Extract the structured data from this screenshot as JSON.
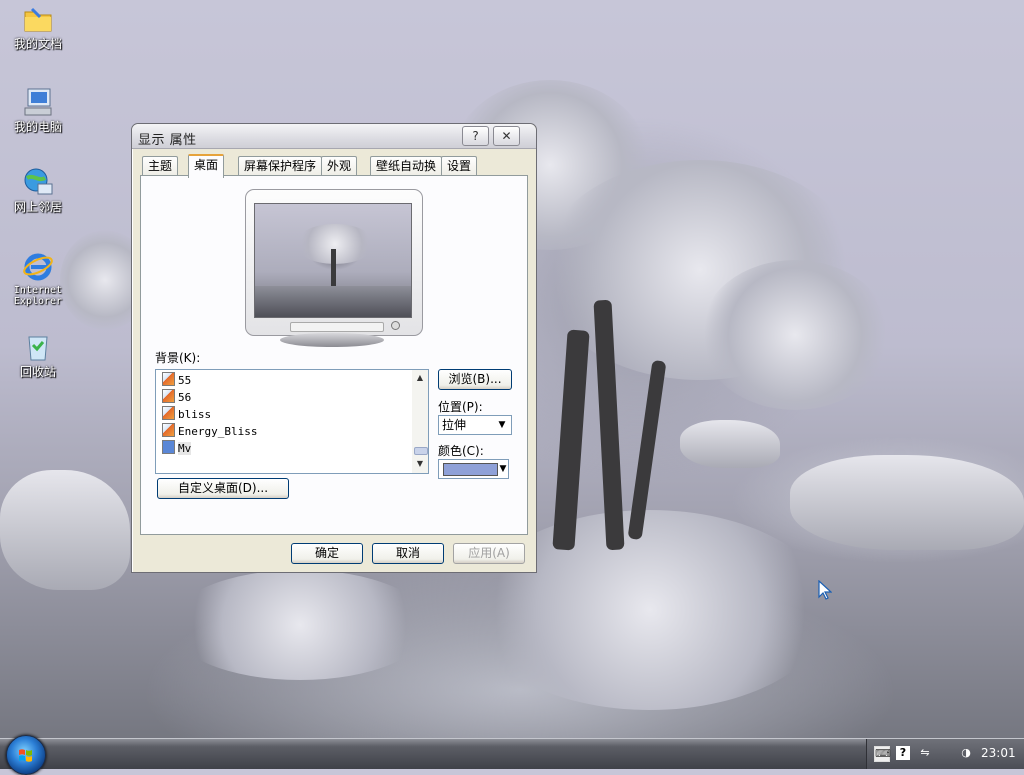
{
  "desktop": {
    "icons": [
      {
        "label": "我的文档"
      },
      {
        "label": "我的电脑"
      },
      {
        "label": "网上邻居"
      },
      {
        "label_line1": "Internet",
        "label_line2": "Explorer"
      },
      {
        "label": "回收站"
      }
    ]
  },
  "dialog": {
    "title": "显示 属性",
    "help_symbol": "?",
    "close_symbol": "✕",
    "tabs": [
      {
        "label": "主题"
      },
      {
        "label": "桌面",
        "active": true
      },
      {
        "label": "屏幕保护程序"
      },
      {
        "label": "外观"
      },
      {
        "label": "壁纸自动换"
      },
      {
        "label": "设置"
      }
    ],
    "background_label": "背景(K):",
    "background_items": [
      {
        "name": "55"
      },
      {
        "name": "56"
      },
      {
        "name": "bliss"
      },
      {
        "name": "Energy_Bliss"
      },
      {
        "name": "Mv",
        "selected": true
      }
    ],
    "browse_button": "浏览(B)...",
    "position_label": "位置(P):",
    "position_value": "拉伸",
    "color_label": "颜色(C):",
    "color_value": "#8fa1d8",
    "customize_button": "自定义桌面(D)...",
    "ok_button": "确定",
    "cancel_button": "取消",
    "apply_button": "应用(A)"
  },
  "taskbar": {
    "clock": "23:01",
    "tray_icons": [
      "keyboard-icon",
      "help-icon",
      "network-icon",
      "volume-icon"
    ]
  }
}
